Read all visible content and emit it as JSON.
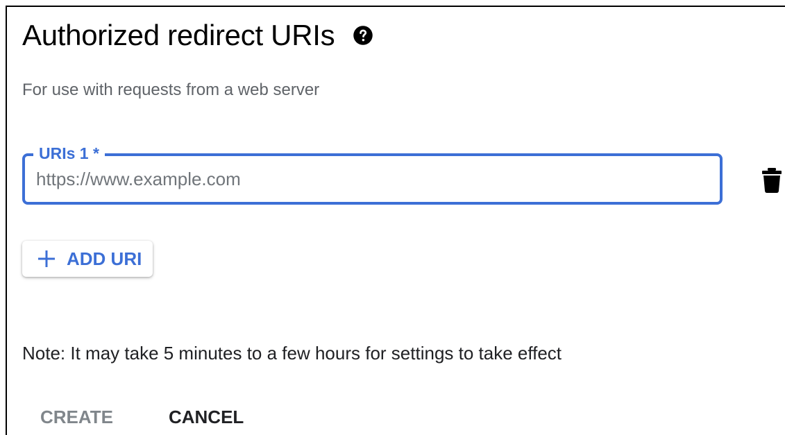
{
  "section": {
    "title": "Authorized redirect URIs",
    "help_icon": "help-circle-icon",
    "subtitle": "For use with requests from a web server"
  },
  "uri_field": {
    "label": "URIs 1 *",
    "value": "",
    "placeholder": "https://www.example.com",
    "accent_color": "#3c6fd6",
    "delete_icon": "trash-icon"
  },
  "add_button": {
    "icon": "plus-icon",
    "label": "ADD URI"
  },
  "note": "Note: It may take 5 minutes to a few hours for settings to take effect",
  "actions": {
    "create_label": "CREATE",
    "cancel_label": "CANCEL",
    "create_color": "#80868b"
  }
}
